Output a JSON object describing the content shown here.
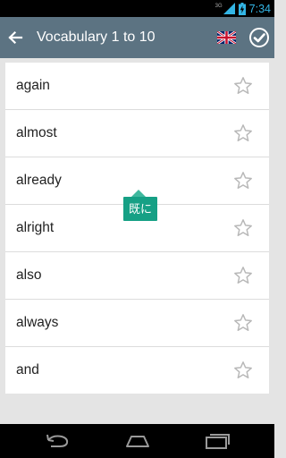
{
  "status_bar": {
    "network": "3G",
    "time": "7:34",
    "accent_color": "#33b5e5"
  },
  "header": {
    "title": "Vocabulary 1 to 10",
    "background_color": "#5c7382",
    "icons": [
      "back-arrow-icon",
      "uk-flag-icon",
      "check-circle-icon"
    ]
  },
  "words": [
    {
      "word": "again",
      "starred": false
    },
    {
      "word": "almost",
      "starred": false
    },
    {
      "word": "already",
      "starred": false
    },
    {
      "word": "alright",
      "starred": false
    },
    {
      "word": "also",
      "starred": false
    },
    {
      "word": "always",
      "starred": false
    },
    {
      "word": "and",
      "starred": false
    }
  ],
  "tooltip": {
    "text": "既に",
    "color": "#16a085"
  },
  "nav_bar": {
    "icons": [
      "nav-back-icon",
      "nav-home-icon",
      "nav-recents-icon"
    ]
  }
}
